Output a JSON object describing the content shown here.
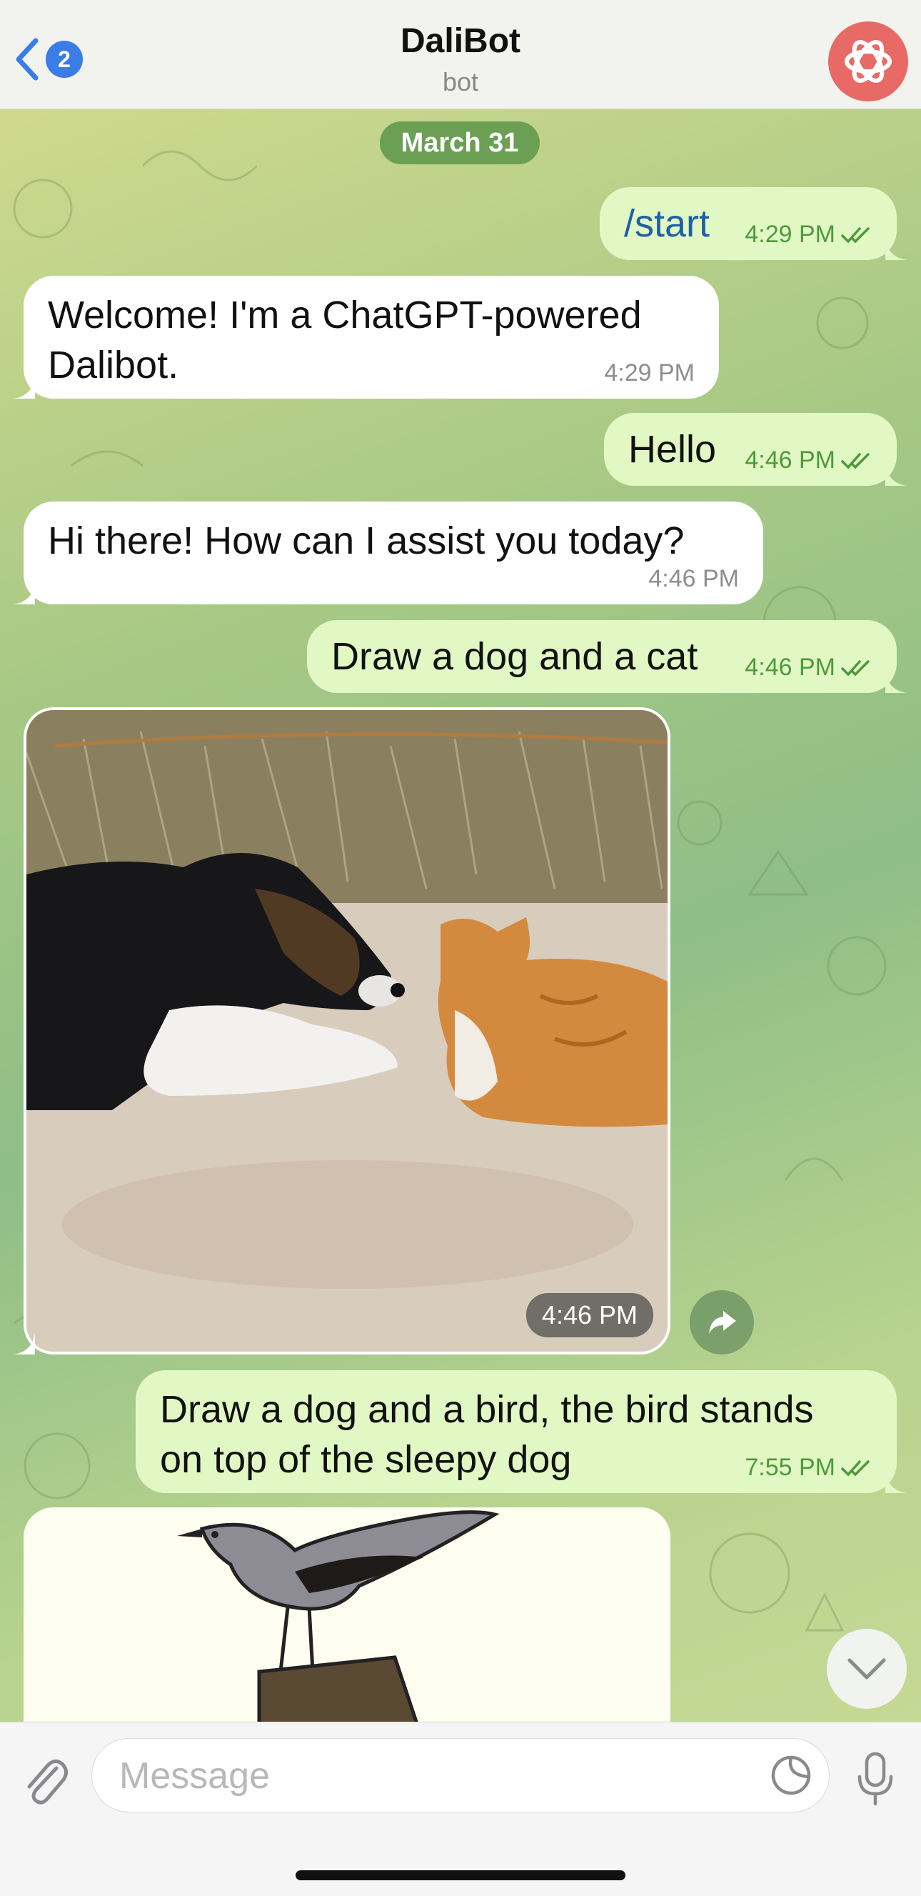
{
  "header": {
    "back_badge": "2",
    "title": "DaliBot",
    "subtitle": "bot"
  },
  "chat": {
    "date": "March 31",
    "messages": [
      {
        "text": "/start",
        "time": "4:29 PM"
      },
      {
        "line1": "Welcome! I'm a ChatGPT-powered",
        "line2": "Dalibot.",
        "time": "4:29 PM"
      },
      {
        "text": "Hello",
        "time": "4:46 PM"
      },
      {
        "text": "Hi there! How can I assist you today?",
        "time": "4:46 PM"
      },
      {
        "text": "Draw a dog and a cat",
        "time": "4:46 PM"
      },
      {
        "time": "4:46 PM"
      },
      {
        "line1": "Draw a dog and a bird, the bird stands",
        "line2": "on top of the sleepy dog",
        "time": "7:55 PM"
      }
    ]
  },
  "composer": {
    "placeholder": "Message"
  },
  "colors": {
    "accent": "#3a7de8",
    "outgoing_bubble": "#e2f8c4",
    "incoming_bubble": "#ffffff",
    "outgoing_time": "#4d9a3a",
    "avatar": "#e86a66",
    "date_pill": "#6b9f54"
  },
  "icons": [
    "chevron-left-icon",
    "openai-logo-icon",
    "double-check-icon",
    "share-icon",
    "chevron-down-icon",
    "paperclip-icon",
    "sticker-icon",
    "microphone-icon"
  ]
}
